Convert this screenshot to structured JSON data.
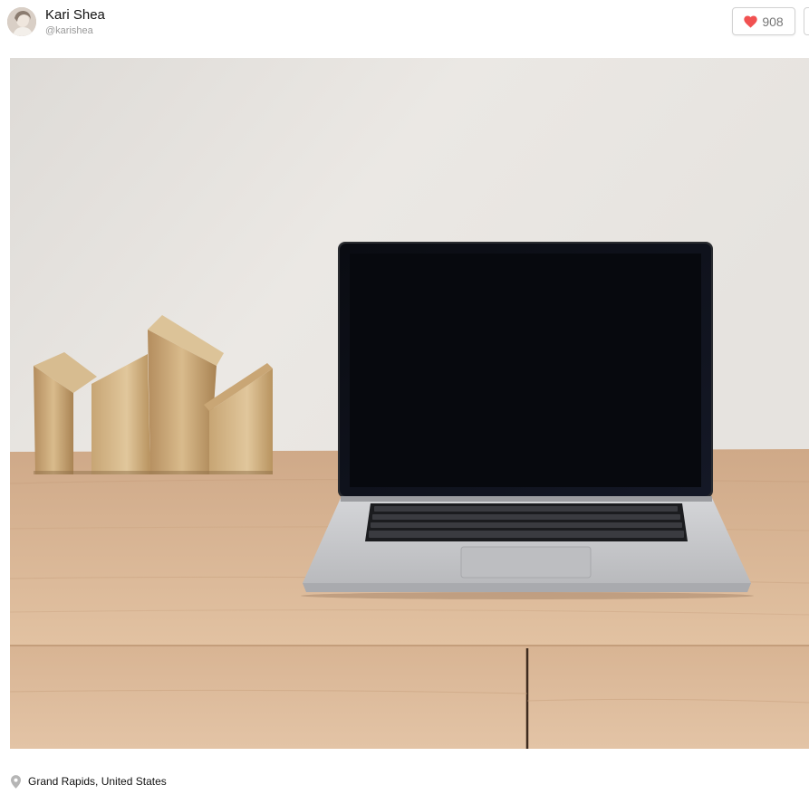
{
  "user": {
    "name": "Kari Shea",
    "handle": "@karishea"
  },
  "actions": {
    "like_count": "908"
  },
  "location": {
    "text": "Grand Rapids, United States"
  },
  "colors": {
    "heart": "#f15151",
    "wall": "#e6e3df",
    "desk_wood": "#d9b491",
    "laptop_screen": "#0d0f16",
    "laptop_body": "#cfd0d2",
    "brass": "#c9a574"
  },
  "icons": {
    "like": "heart-icon",
    "location": "map-pin-icon"
  }
}
